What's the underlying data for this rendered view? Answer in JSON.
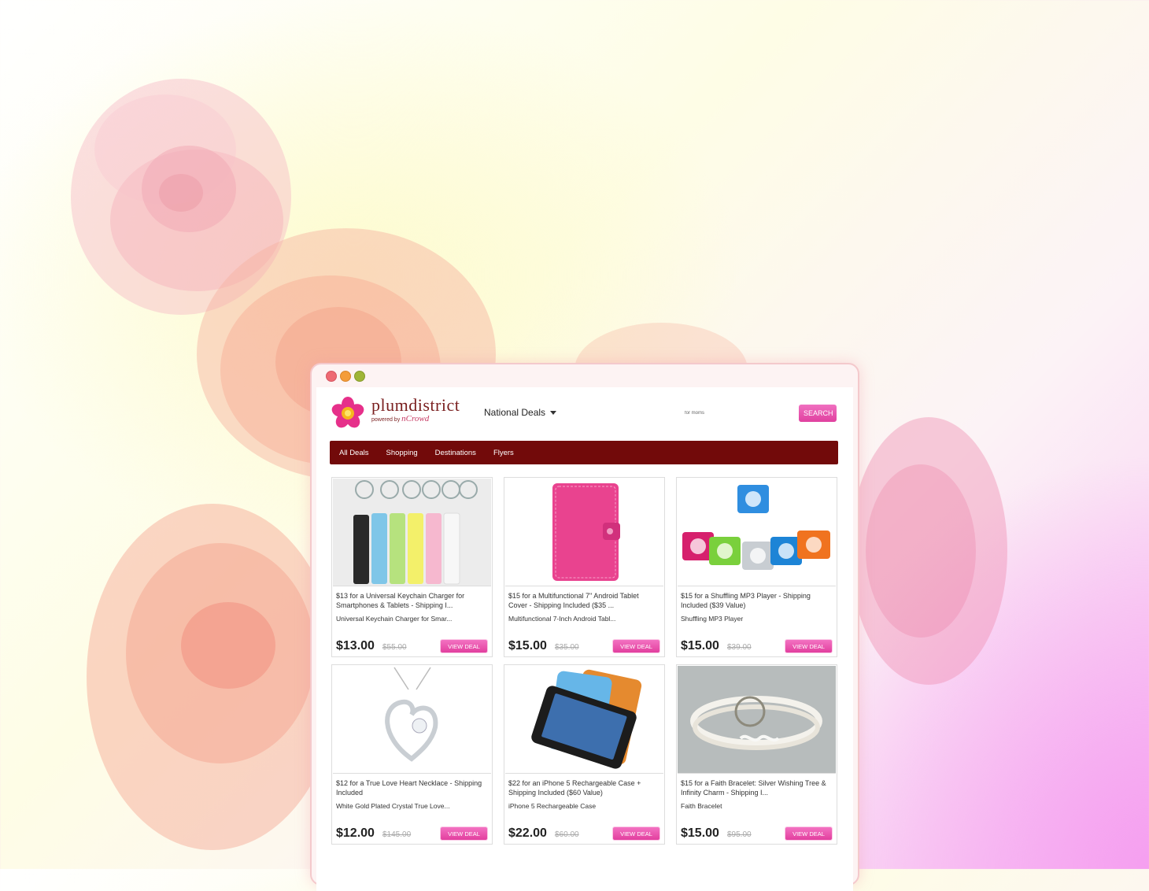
{
  "brand": {
    "name": "plumdistrict",
    "powered_by": "powered by",
    "partner": "nCrowd"
  },
  "header": {
    "region": "National Deals",
    "search_value": "for moms",
    "search_button": "SEARCH"
  },
  "nav": {
    "items": [
      "All Deals",
      "Shopping",
      "Destinations",
      "Flyers"
    ]
  },
  "deals": [
    {
      "title": "$13 for a Universal Keychain Charger for Smartphones & Tablets - Shipping I...",
      "subtitle": "Universal Keychain Charger for Smar...",
      "price": "$13.00",
      "old_price": "$55.00",
      "button": "VIEW DEAL"
    },
    {
      "title": "$15 for a Multifunctional 7\" Android Tablet Cover - Shipping Included ($35 ...",
      "subtitle": "Multifunctional 7-Inch Android Tabl...",
      "price": "$15.00",
      "old_price": "$35.00",
      "button": "VIEW DEAL"
    },
    {
      "title": "$15 for a Shuffling MP3 Player - Shipping Included ($39 Value)",
      "subtitle": "Shuffling MP3 Player",
      "price": "$15.00",
      "old_price": "$39.00",
      "button": "VIEW DEAL"
    },
    {
      "title": "$12 for a True Love Heart Necklace - Shipping Included",
      "subtitle": "White Gold Plated Crystal True Love...",
      "price": "$12.00",
      "old_price": "$145.00",
      "button": "VIEW DEAL"
    },
    {
      "title": "$22 for an iPhone 5 Rechargeable Case + Shipping Included ($60 Value)",
      "subtitle": "iPhone 5 Rechargeable Case",
      "price": "$22.00",
      "old_price": "$60.00",
      "button": "VIEW DEAL"
    },
    {
      "title": "$15 for a Faith Bracelet: Silver Wishing Tree & Infinity Charm - Shipping I...",
      "subtitle": "Faith Bracelet",
      "price": "$15.00",
      "old_price": "$95.00",
      "button": "VIEW DEAL"
    }
  ],
  "colors": {
    "nav_bg": "#720a0a",
    "accent_pink": "#e8479f",
    "brand_maroon": "#7a1f1f"
  }
}
